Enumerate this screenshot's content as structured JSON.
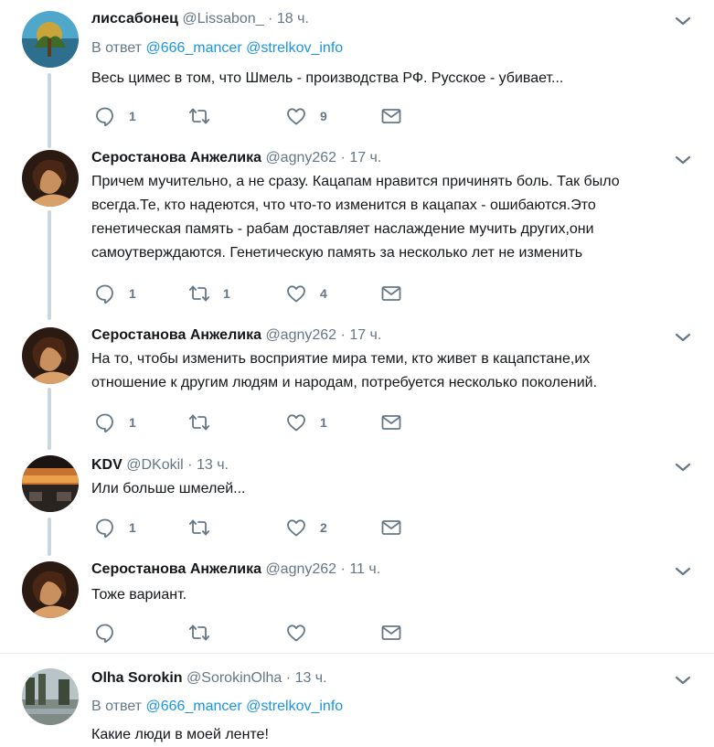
{
  "colors": {
    "text": "#14171a",
    "secondary": "#657786",
    "link": "#1b95e0",
    "thread_line": "#ccd6dd",
    "divider": "#e6ecf0"
  },
  "icons": {
    "reply": "reply-icon",
    "retweet": "retweet-icon",
    "like": "heart-icon",
    "dm": "envelope-icon",
    "menu": "chevron-down-icon"
  },
  "tweets": [
    {
      "name": "лиссабонец",
      "handle": "@Lissabon_",
      "dot": "·",
      "time": "18 ч.",
      "reply_prefix": "В ответ",
      "reply_to_1": "@666_mancer",
      "reply_to_2": "@strelkov_info",
      "text": "Весь цимес в том, что Шмель - производства РФ. Русское - убивает...",
      "replies": "1",
      "retweets": "",
      "likes": "9"
    },
    {
      "name": "Серостанова Анжелика",
      "handle": "@agny262",
      "dot": "·",
      "time": "17 ч.",
      "text_lines": [
        "Причем мучительно, а не сразу. Кацапам нравится причинять боль. Так было",
        "всегда.Те, кто надеются, что что-то изменится в кацапах - ошибаются.Это",
        "генетическая память - рабам доставляет наслаждение мучить других,они",
        "самоутверждаются. Генетическую память за несколько лет не изменить"
      ],
      "replies": "1",
      "retweets": "1",
      "likes": "4"
    },
    {
      "name": "Серостанова Анжелика",
      "handle": "@agny262",
      "dot": "·",
      "time": "17 ч.",
      "text_lines": [
        "На то, чтобы изменить восприятие мира теми, кто живет в кацапстане,их",
        "отношение к другим людям и народам, потребуется несколько поколений."
      ],
      "replies": "1",
      "retweets": "",
      "likes": "1"
    },
    {
      "name": "KDV",
      "handle": "@DKokil",
      "dot": "·",
      "time": "13 ч.",
      "text": "Или больше шмелей...",
      "replies": "1",
      "retweets": "",
      "likes": "2"
    },
    {
      "name": "Серостанова Анжелика",
      "handle": "@agny262",
      "dot": "·",
      "time": "11 ч.",
      "text": "Тоже вариант.",
      "replies": "",
      "retweets": "",
      "likes": ""
    },
    {
      "name": "Olha Sorokin",
      "handle": "@SorokinOlha",
      "dot": "·",
      "time": "13 ч.",
      "reply_prefix": "В ответ",
      "reply_to_1": "@666_mancer",
      "reply_to_2": "@strelkov_info",
      "text": "Какие люди в моей ленте!"
    }
  ]
}
